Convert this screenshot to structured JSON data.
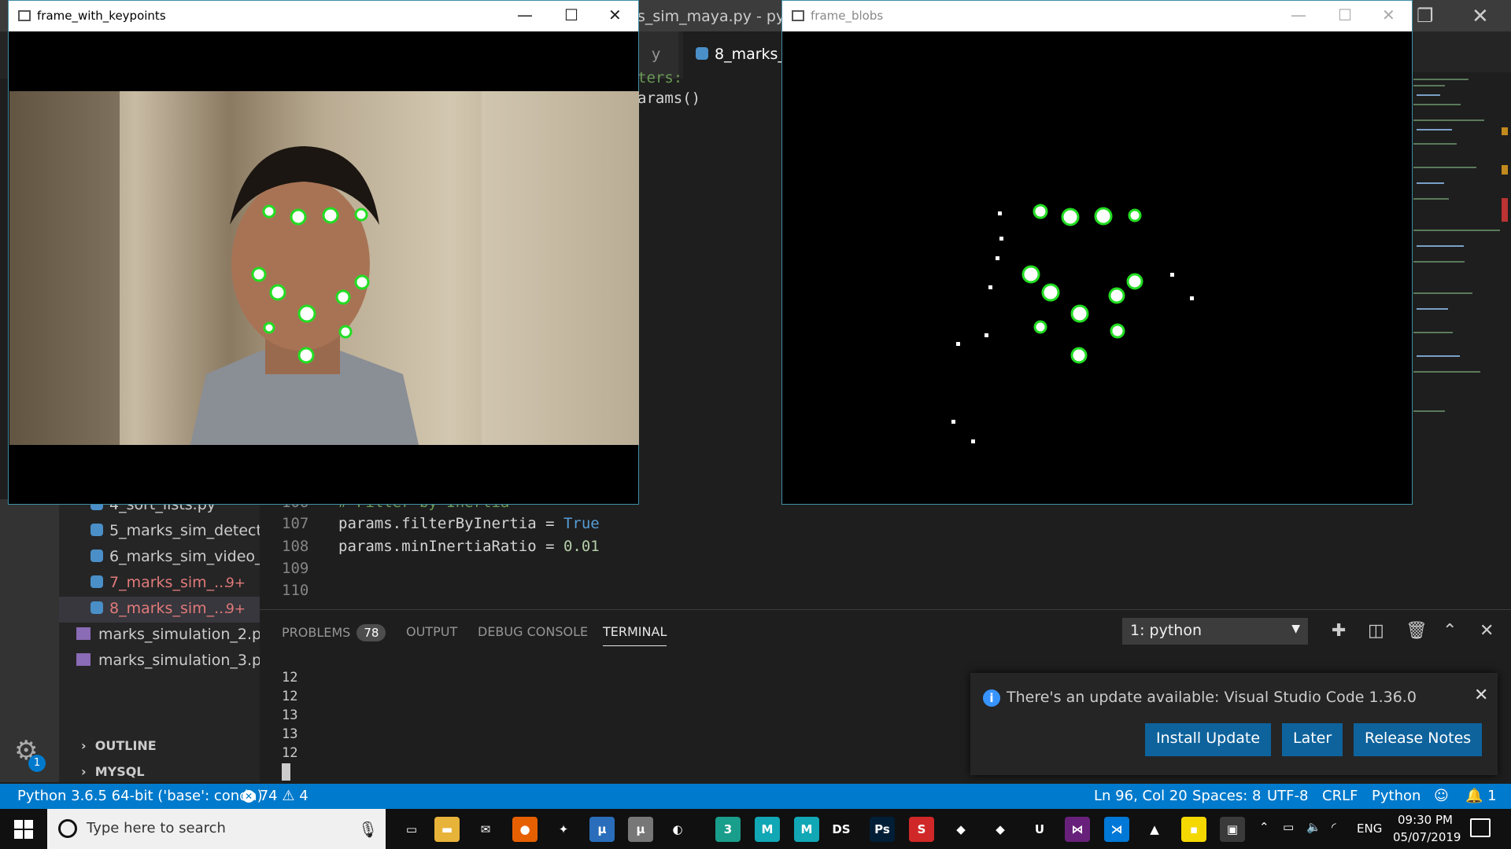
{
  "vscode": {
    "title_fragment": "s_sim_maya.py - pytho",
    "tabs": [
      {
        "label": "y",
        "active": false
      },
      {
        "label": "8_marks_s",
        "active": true
      }
    ],
    "editor_top_lines": [
      {
        "text": "ters:",
        "class": "comment"
      },
      {
        "text": "arams()",
        "class": "plain"
      }
    ],
    "editor_bottom": {
      "partial_top": "# Filter by Inertia",
      "lines": [
        {
          "num": "106",
          "text": ""
        },
        {
          "num": "107",
          "code_var": "params.filterByInertia = ",
          "code_val": "True"
        },
        {
          "num": "108",
          "code_var": "params.minInertiaRatio = ",
          "code_val": "0.01"
        },
        {
          "num": "109",
          "text": ""
        },
        {
          "num": "110",
          "text": ""
        }
      ]
    },
    "explorer": {
      "files": [
        {
          "label": "4_sort_lists.py",
          "type": "py",
          "modified": false,
          "selected": false,
          "badge": ""
        },
        {
          "label": "5_marks_sim_detect...",
          "type": "py",
          "modified": false,
          "selected": false,
          "badge": ""
        },
        {
          "label": "6_marks_sim_video_...",
          "type": "py",
          "modified": false,
          "selected": false,
          "badge": ""
        },
        {
          "label": "7_marks_sim_...",
          "type": "py",
          "modified": true,
          "selected": false,
          "badge": "9+"
        },
        {
          "label": "8_marks_sim_...",
          "type": "py",
          "modified": true,
          "selected": true,
          "badge": "9+"
        },
        {
          "label": "marks_simulation_2.p...",
          "type": "img",
          "modified": false,
          "selected": false,
          "badge": ""
        },
        {
          "label": "marks_simulation_3.p...",
          "type": "img",
          "modified": false,
          "selected": false,
          "badge": ""
        }
      ],
      "sections": [
        "OUTLINE",
        "MYSQL"
      ],
      "settings_badge": "1"
    },
    "panel": {
      "tabs": [
        {
          "label": "PROBLEMS",
          "count": "78",
          "active": false
        },
        {
          "label": "OUTPUT",
          "active": false
        },
        {
          "label": "DEBUG CONSOLE",
          "active": false
        },
        {
          "label": "TERMINAL",
          "active": true
        }
      ],
      "terminal_select": "1: python",
      "terminal_lines": [
        "12",
        "12",
        "13",
        "13",
        "12"
      ]
    },
    "notification": {
      "message": "There's an update available: Visual Studio Code 1.36.0",
      "buttons": [
        "Install Update",
        "Later",
        "Release Notes"
      ]
    },
    "statusbar": {
      "interpreter": "Python 3.6.5 64-bit ('base': conda)",
      "errors": "74",
      "warnings": "4",
      "position": "Ln 96, Col 20",
      "spaces": "Spaces: 8",
      "encoding": "UTF-8",
      "eol": "CRLF",
      "language": "Python",
      "bell_count": "1"
    }
  },
  "windows": {
    "keypoints": {
      "title": "frame_with_keypoints"
    },
    "blobs": {
      "title": "frame_blobs"
    }
  },
  "taskbar": {
    "search_placeholder": "Type here to search",
    "apps": [
      {
        "name": "task-view",
        "glyph": "▭",
        "color": "#101010"
      },
      {
        "name": "file-explorer",
        "glyph": "▬",
        "color": "#e8b339"
      },
      {
        "name": "mail",
        "glyph": "✉",
        "color": "#101010"
      },
      {
        "name": "firefox",
        "glyph": "●",
        "color": "#e66000"
      },
      {
        "name": "app-orange",
        "glyph": "✦",
        "color": "#101010"
      },
      {
        "name": "mu-editor",
        "glyph": "μ",
        "color": "#2a6ebb"
      },
      {
        "name": "mu-grey",
        "glyph": "μ",
        "color": "#777777"
      },
      {
        "name": "blender",
        "glyph": "◐",
        "color": "#101010"
      },
      {
        "name": "3ds-max",
        "glyph": "3",
        "color": "#1a9e8c"
      },
      {
        "name": "maya-1",
        "glyph": "M",
        "color": "#11a7b5"
      },
      {
        "name": "maya-2",
        "glyph": "M",
        "color": "#11a7b5"
      },
      {
        "name": "daz-studio",
        "glyph": "DS",
        "color": "#101010"
      },
      {
        "name": "photoshop",
        "glyph": "Ps",
        "color": "#001e36"
      },
      {
        "name": "substance",
        "glyph": "S",
        "color": "#d02828"
      },
      {
        "name": "unity-1",
        "glyph": "◆",
        "color": "#101010"
      },
      {
        "name": "unity-2",
        "glyph": "◆",
        "color": "#101010"
      },
      {
        "name": "unreal",
        "glyph": "U",
        "color": "#101010"
      },
      {
        "name": "visual-studio",
        "glyph": "⋈",
        "color": "#68217a"
      },
      {
        "name": "vscode",
        "glyph": "⋊",
        "color": "#0078d7"
      },
      {
        "name": "matlab",
        "glyph": "▲",
        "color": "#101010"
      },
      {
        "name": "sticky-notes",
        "glyph": "▪",
        "color": "#f5d800"
      },
      {
        "name": "opencv-window",
        "glyph": "▣",
        "color": "#3a3a3a"
      }
    ],
    "tray_lang": "ENG",
    "time": "09:30 PM",
    "date": "05/07/2019"
  }
}
